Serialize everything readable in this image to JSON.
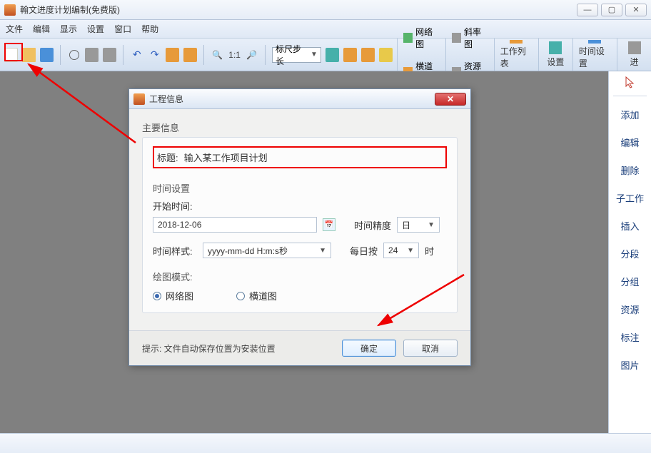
{
  "window": {
    "title": "翰文进度计划编制(免费版)",
    "min": "—",
    "restore": "▢",
    "close": "✕"
  },
  "menu": [
    "文件",
    "编辑",
    "显示",
    "设置",
    "窗口",
    "帮助"
  ],
  "toolbar": {
    "ruler_label": "标尺步长",
    "one_to_one": "1:1"
  },
  "ribbon": {
    "net": "网络图",
    "gantt": "横道图",
    "slope": "斜率图",
    "resource": "资源图",
    "worklist": "工作列表",
    "settings": "设置",
    "timesettings": "时间设置",
    "more": "进"
  },
  "sidebar": [
    "添加",
    "编辑",
    "删除",
    "子工作",
    "插入",
    "分段",
    "分组",
    "资源",
    "标注",
    "图片"
  ],
  "dialog": {
    "title": "工程信息",
    "section_main": "主要信息",
    "label_title": "标题:",
    "title_value": "输入某工作项目计划",
    "section_time": "时间设置",
    "label_start": "开始时间:",
    "start_value": "2018-12-06",
    "label_precision": "时间精度",
    "precision_value": "日",
    "label_format": "时间样式:",
    "format_value": "yyyy-mm-dd H:m:s秒",
    "label_daily": "每日按",
    "daily_value": "24",
    "daily_unit": "时",
    "section_draw": "绘图模式:",
    "radio_net": "网络图",
    "radio_gantt": "横道图",
    "hint": "提示: 文件自动保存位置为安装位置",
    "ok": "确定",
    "cancel": "取消",
    "close_x": "✕"
  }
}
